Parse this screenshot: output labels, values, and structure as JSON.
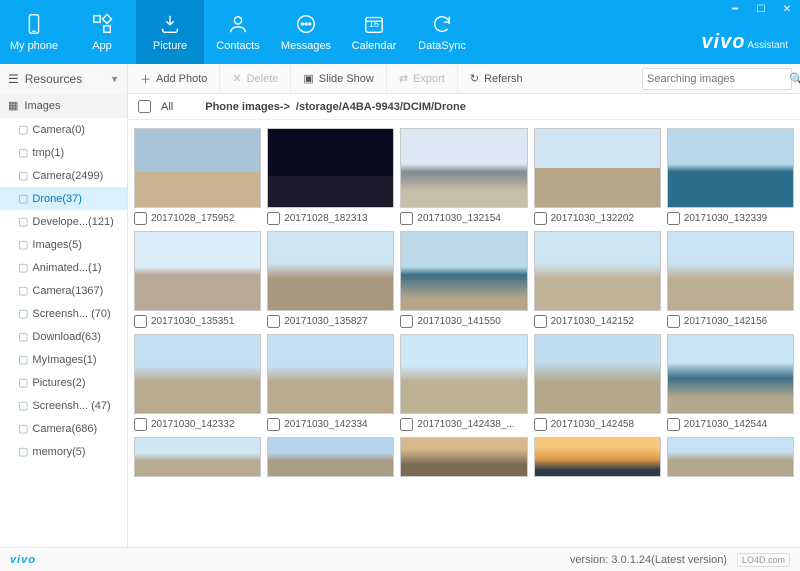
{
  "brand": {
    "name": "vivo",
    "suffix": "Assistant"
  },
  "nav": {
    "items": [
      {
        "label": "My phone"
      },
      {
        "label": "App"
      },
      {
        "label": "Picture"
      },
      {
        "label": "Contacts"
      },
      {
        "label": "Messages"
      },
      {
        "label": "Calendar",
        "badge": "16"
      },
      {
        "label": "DataSync"
      }
    ],
    "active_index": 2
  },
  "sidebar": {
    "header": "Resources",
    "group": "Images",
    "items": [
      {
        "label": "Camera(0)"
      },
      {
        "label": "tmp(1)"
      },
      {
        "label": "Camera(2499)"
      },
      {
        "label": "Drone(37)",
        "selected": true
      },
      {
        "label": "Develope...(121)"
      },
      {
        "label": "Images(5)"
      },
      {
        "label": "Animated...(1)"
      },
      {
        "label": "Camera(1367)"
      },
      {
        "label": "Screensh... (70)"
      },
      {
        "label": "Download(63)"
      },
      {
        "label": "MyImages(1)"
      },
      {
        "label": "Pictures(2)"
      },
      {
        "label": "Screensh... (47)"
      },
      {
        "label": "Camera(686)"
      },
      {
        "label": "memory(5)"
      }
    ]
  },
  "toolbar": {
    "add_photo": "Add Photo",
    "delete": "Delete",
    "slide_show": "Slide Show",
    "export": "Export",
    "refresh": "Refersh",
    "search_placeholder": "Searching images"
  },
  "breadcrumb": {
    "all_label": "All",
    "path_prefix": "Phone images->",
    "path": "/storage/A4BA-9943/DCIM/Drone"
  },
  "grid": {
    "items": [
      {
        "name": "20171028_175952"
      },
      {
        "name": "20171028_182313"
      },
      {
        "name": "20171030_132154"
      },
      {
        "name": "20171030_132202"
      },
      {
        "name": "20171030_132339"
      },
      {
        "name": "20171030_135351"
      },
      {
        "name": "20171030_135827"
      },
      {
        "name": "20171030_141550"
      },
      {
        "name": "20171030_142152"
      },
      {
        "name": "20171030_142156"
      },
      {
        "name": "20171030_142332"
      },
      {
        "name": "20171030_142334"
      },
      {
        "name": "20171030_142438_..."
      },
      {
        "name": "20171030_142458"
      },
      {
        "name": "20171030_142544"
      }
    ]
  },
  "status": {
    "brand": "vivo",
    "version_label": "version:",
    "version_value": "3.0.1.24(Latest version)",
    "site": "LO4D.com"
  }
}
